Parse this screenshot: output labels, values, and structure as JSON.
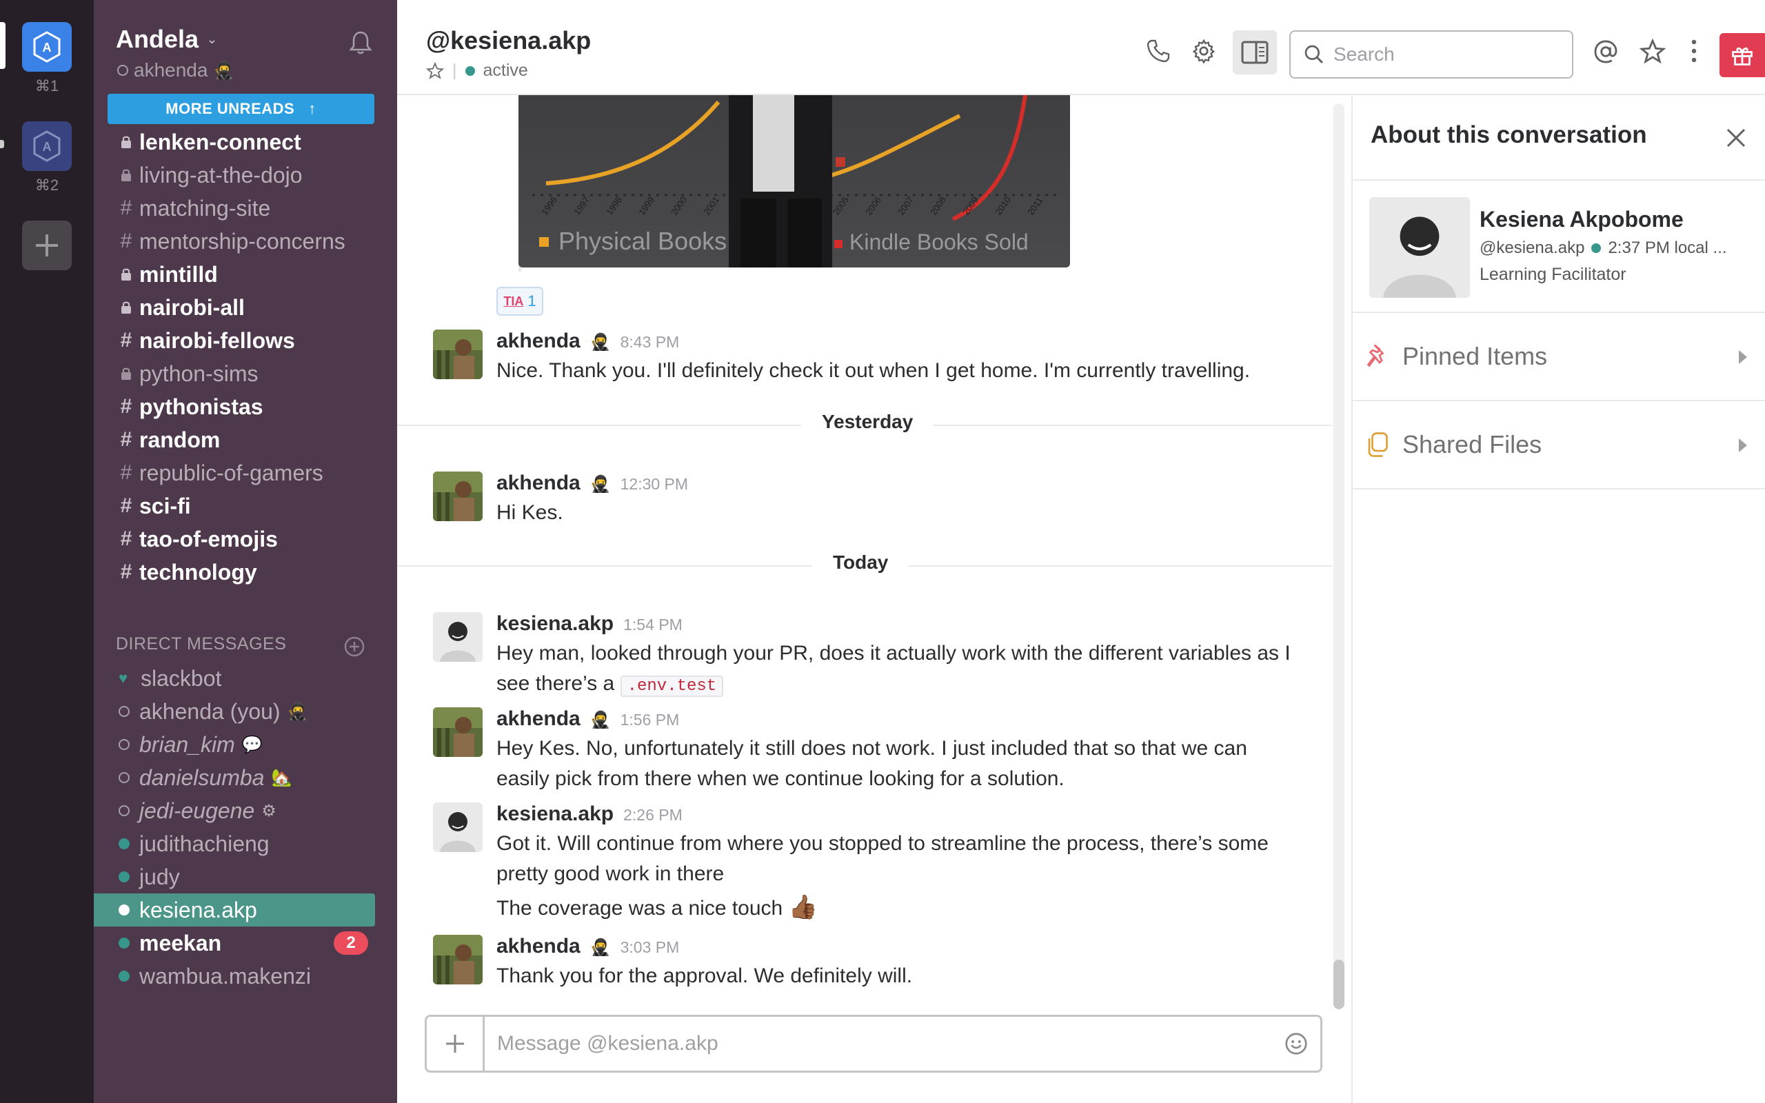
{
  "teams": [
    {
      "shortcut": "⌘1",
      "active": true
    },
    {
      "shortcut": "⌘2",
      "active": false
    }
  ],
  "sidebar": {
    "team_name": "Andela",
    "user_name": "akhenda",
    "more_unreads": "MORE UNREADS",
    "channels": [
      {
        "name": "lenken-connect",
        "private": true,
        "unread": true
      },
      {
        "name": "living-at-the-dojo",
        "private": true,
        "unread": false
      },
      {
        "name": "matching-site",
        "private": false,
        "unread": false
      },
      {
        "name": "mentorship-concerns",
        "private": false,
        "unread": false
      },
      {
        "name": "mintilld",
        "private": true,
        "unread": true
      },
      {
        "name": "nairobi-all",
        "private": true,
        "unread": true
      },
      {
        "name": "nairobi-fellows",
        "private": false,
        "unread": true
      },
      {
        "name": "python-sims",
        "private": true,
        "unread": false
      },
      {
        "name": "pythonistas",
        "private": false,
        "unread": true
      },
      {
        "name": "random",
        "private": false,
        "unread": true
      },
      {
        "name": "republic-of-gamers",
        "private": false,
        "unread": false
      },
      {
        "name": "sci-fi",
        "private": false,
        "unread": true
      },
      {
        "name": "tao-of-emojis",
        "private": false,
        "unread": true
      },
      {
        "name": "technology",
        "private": false,
        "unread": true
      }
    ],
    "dm_header": "DIRECT MESSAGES",
    "dms": [
      {
        "name": "slackbot",
        "status": "heart"
      },
      {
        "name": "akhenda (you)",
        "status": "away",
        "emoji": "🥷"
      },
      {
        "name": "brian_kim",
        "status": "away",
        "italic": true,
        "emoji": "💬"
      },
      {
        "name": "danielsumba",
        "status": "away",
        "italic": true,
        "emoji": "🏡"
      },
      {
        "name": "jedi-eugene",
        "status": "away",
        "italic": true,
        "emoji": "⚙"
      },
      {
        "name": "judithachieng",
        "status": "on"
      },
      {
        "name": "judy",
        "status": "on"
      },
      {
        "name": "kesiena.akp",
        "status": "on-white",
        "active": true
      },
      {
        "name": "meekan",
        "status": "on",
        "bold": true,
        "badge": "2"
      },
      {
        "name": "wambua.makenzi",
        "status": "on"
      }
    ]
  },
  "header": {
    "title": "@kesiena.akp",
    "status": "active",
    "search_placeholder": "Search"
  },
  "chart_image": {
    "legend_left": "Physical Books",
    "legend_right": "Kindle Books Sold",
    "years": [
      "1996",
      "1997",
      "1998",
      "1999",
      "2000",
      "2001",
      "2002",
      "2003",
      "2004",
      "2005",
      "2006",
      "2007",
      "2008",
      "2009",
      "2010",
      "2011"
    ]
  },
  "reaction": {
    "label": "TIA",
    "count": "1"
  },
  "days": {
    "yesterday": "Yesterday",
    "today": "Today"
  },
  "messages": [
    {
      "sender": "akhenda",
      "emoji": "🥷",
      "time": "8:43 PM",
      "text": "Nice. Thank you. I'll definitely check it out when I get home. I'm currently travelling."
    },
    {
      "sender": "akhenda",
      "emoji": "🥷",
      "time": "12:30 PM",
      "text": "Hi Kes."
    },
    {
      "sender": "kesiena.akp",
      "time": "1:54 PM",
      "text": "Hey man, looked through your PR, does it actually work with the different variables as I see there’s a",
      "code": ".env.test"
    },
    {
      "sender": "akhenda",
      "emoji": "🥷",
      "time": "1:56 PM",
      "text": "Hey Kes. No, unfortunately it still does not work. I just included that so that we can easily pick from there when we continue looking for a solution."
    },
    {
      "sender": "kesiena.akp",
      "time": "2:26 PM",
      "text": "Got it. Will continue from where you stopped to streamline the process, there’s some pretty good work in there",
      "text2": "The coverage was a nice touch",
      "text2_emoji": "👍🏾"
    },
    {
      "sender": "akhenda",
      "emoji": "🥷",
      "time": "3:03 PM",
      "text": "Thank you for the approval. We definitely will."
    }
  ],
  "composer": {
    "placeholder": "Message @kesiena.akp"
  },
  "right_panel": {
    "title": "About this conversation",
    "profile_name": "Kesiena Akpobome",
    "profile_handle": "@kesiena.akp",
    "profile_time": "2:37 PM local ...",
    "profile_role": "Learning Facilitator",
    "pinned": "Pinned Items",
    "files": "Shared Files"
  }
}
